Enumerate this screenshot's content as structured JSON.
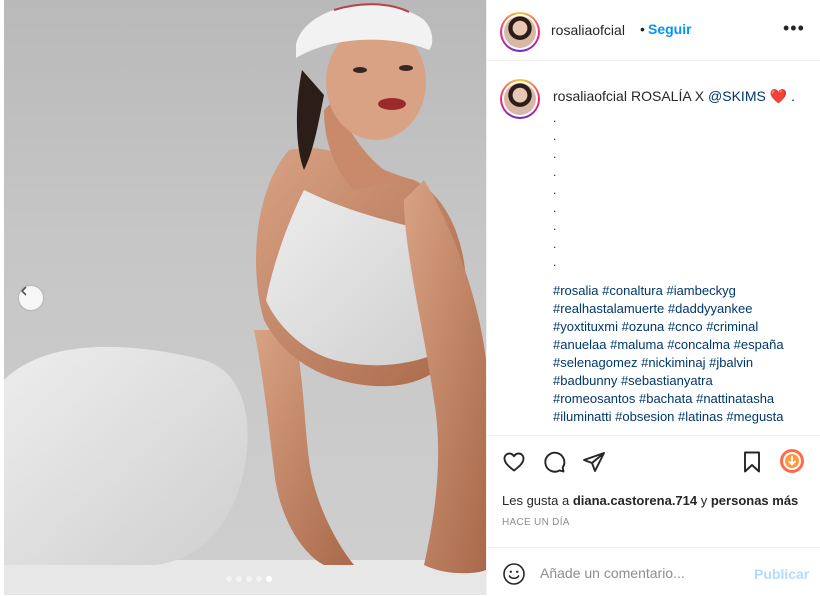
{
  "post": {
    "photo": {
      "carousel_dots": 5,
      "active_dot": 4
    },
    "header": {
      "username": "rosaliaofcial",
      "separator": "•",
      "follow_label": "Seguir",
      "more_label": "•••"
    },
    "caption": {
      "username": "rosaliaofcial",
      "text_before": "ROSALÍA X ",
      "mention": "@SKIMS",
      "heart": "❤️",
      "text_after": " .",
      "dot_lines": [
        ".",
        ".",
        ".",
        ".",
        ".",
        ".",
        ".",
        ".",
        "."
      ],
      "hashtag_lines": [
        "#rosalia #conaltura #iambeckyg",
        "#realhastalamuerte #daddyyankee",
        "#yoxtituxmi #ozuna #cnco #criminal",
        "#anuelaa #maluma #concalma #españa",
        "#selenagomez #nickiminaj #jbalvin",
        "#badbunny #sebastianyatra",
        "#romeosantos #bachata #nattinatasha",
        "#iluminatti #obsesion #latinas #megusta"
      ]
    },
    "likes": {
      "prefix": "Les gusta a ",
      "user": "diana.castorena.714",
      "middle": " y ",
      "suffix": "personas más"
    },
    "timestamp": "HACE UN DÍA",
    "comment": {
      "placeholder": "Añade un comentario...",
      "publish_label": "Publicar"
    },
    "colors": {
      "link_blue": "#0095f6",
      "hashtag_blue": "#00376b",
      "publish_disabled": "#b3dbff",
      "meta_gray": "#8e8e8e"
    }
  }
}
